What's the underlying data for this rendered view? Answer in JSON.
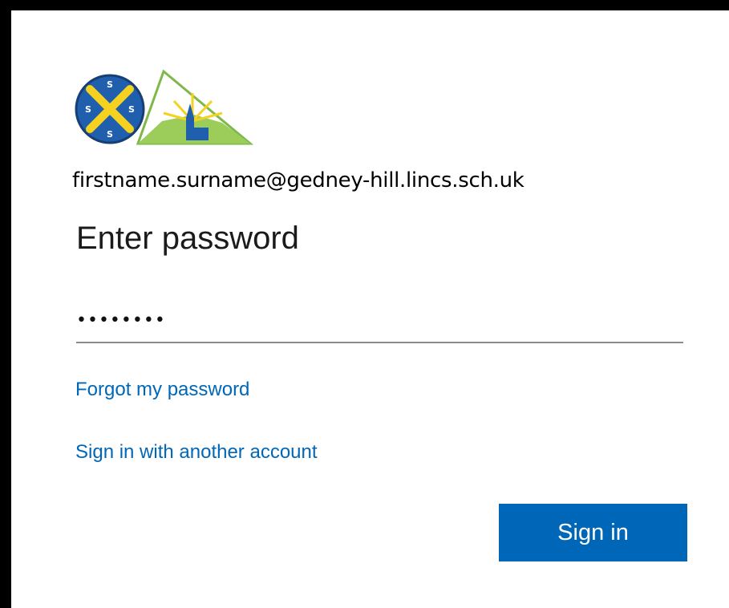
{
  "account": {
    "email": "firstname.surname@gedney-hill.lincs.sch.uk"
  },
  "page": {
    "title": "Enter password"
  },
  "password_field": {
    "value": "••••••••"
  },
  "links": {
    "forgot_password": "Forgot my password",
    "another_account": "Sign in with another account"
  },
  "buttons": {
    "sign_in": "Sign in"
  },
  "logo": {
    "emblem_letters": [
      "S",
      "S",
      "S",
      "S"
    ]
  },
  "colors": {
    "accent": "#0067b8",
    "logo_blue": "#1f5fae",
    "logo_yellow": "#f4d21f",
    "logo_green": "#7fb84a"
  }
}
